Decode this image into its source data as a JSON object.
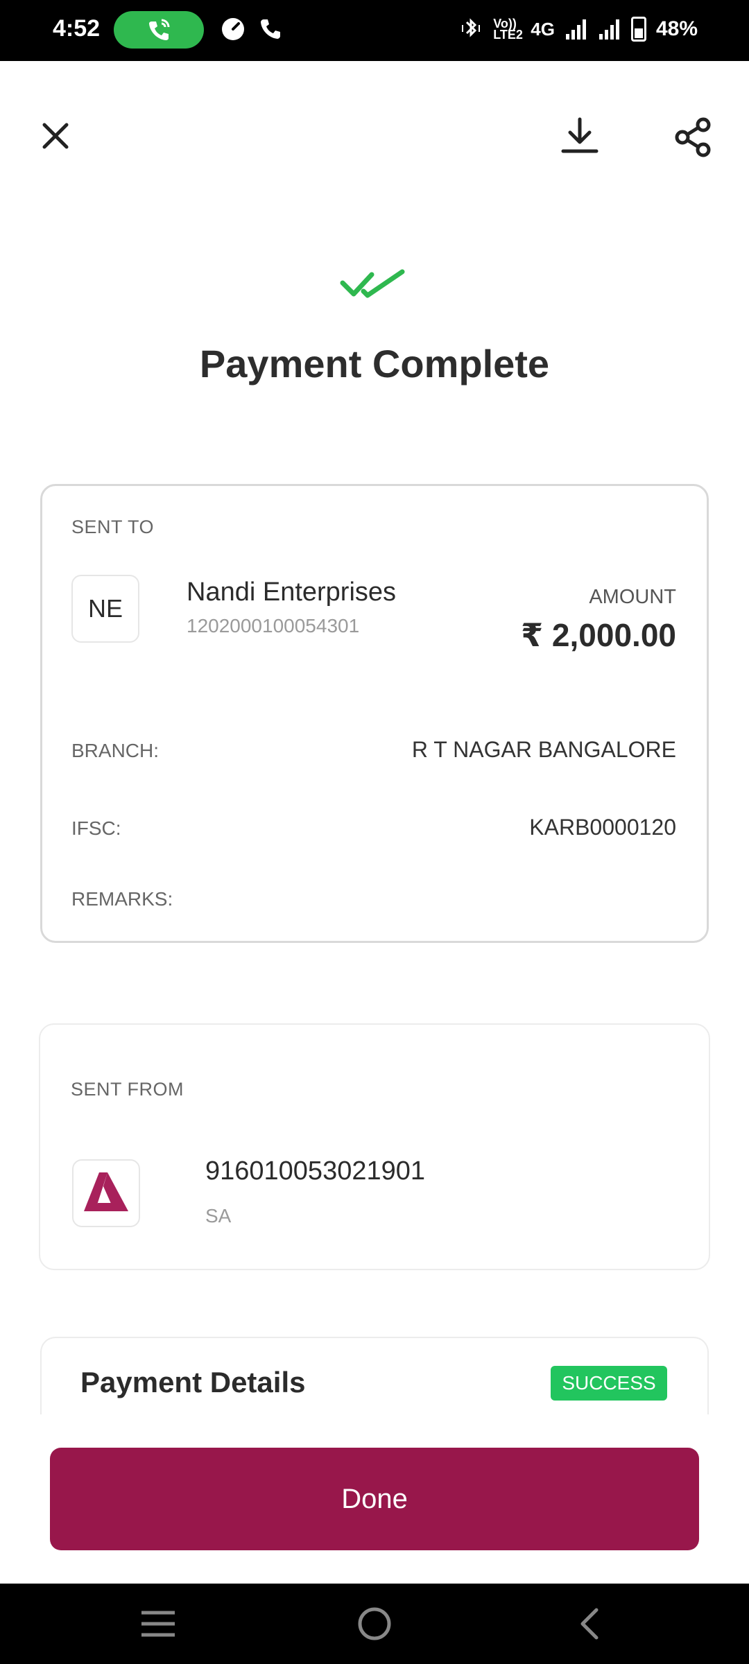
{
  "status_bar": {
    "time": "4:52",
    "volte_text": "Vo)) LTE2",
    "network": "4G",
    "battery": "48%"
  },
  "header": {
    "title": "Payment Complete",
    "icons": [
      "close-icon",
      "download-icon",
      "share-icon",
      "double-check-icon"
    ]
  },
  "sent_to": {
    "label": "SENT TO",
    "avatar_initials": "NE",
    "name": "Nandi Enterprises",
    "account": "1202000100054301",
    "amount_label": "AMOUNT",
    "amount": "₹ 2,000.00",
    "rows": [
      {
        "label": "BRANCH:",
        "value": "R T NAGAR BANGALORE"
      },
      {
        "label": "IFSC:",
        "value": "KARB0000120"
      },
      {
        "label": "REMARKS:",
        "value": ""
      }
    ]
  },
  "sent_from": {
    "label": "SENT FROM",
    "account": "916010053021901",
    "account_type": "SA",
    "bank_logo": "axis-bank-logo"
  },
  "payment_details": {
    "title": "Payment Details",
    "status": "SUCCESS"
  },
  "actions": {
    "done_label": "Done"
  },
  "colors": {
    "accent": "#98174b",
    "success": "#22c55e",
    "check": "#2fb84f"
  }
}
